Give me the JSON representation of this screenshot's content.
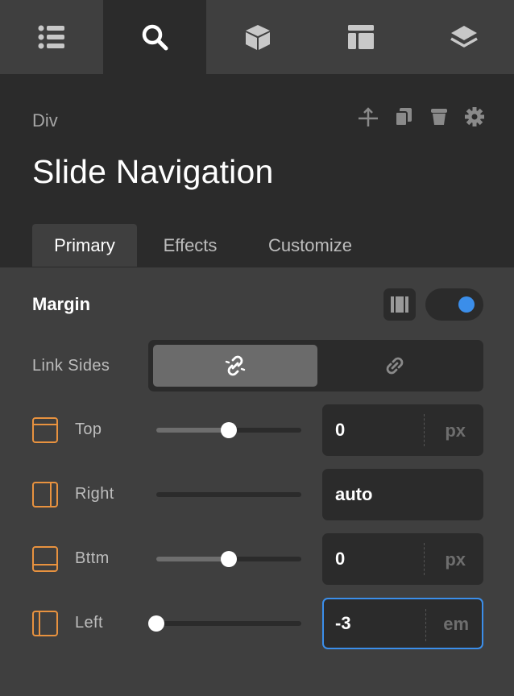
{
  "toolbar": {
    "buttons": [
      {
        "icon": "list-icon",
        "active": false
      },
      {
        "icon": "search-icon",
        "active": true
      },
      {
        "icon": "cube-icon",
        "active": false
      },
      {
        "icon": "layout-icon",
        "active": false
      },
      {
        "icon": "layers-icon",
        "active": false
      }
    ]
  },
  "header": {
    "type_label": "Div",
    "title": "Slide Navigation",
    "actions": [
      "select-parent-icon",
      "duplicate-icon",
      "delete-icon",
      "settings-icon"
    ]
  },
  "tabs": [
    {
      "label": "Primary",
      "active": true
    },
    {
      "label": "Effects",
      "active": false
    },
    {
      "label": "Customize",
      "active": false
    }
  ],
  "margin": {
    "title": "Margin",
    "toggle_on": true,
    "link_sides_label": "Link Sides",
    "link_sides_selected": "unlinked",
    "rows": [
      {
        "label": "Top",
        "value": "0",
        "unit": "px",
        "slider": 0.5
      },
      {
        "label": "Right",
        "value": "auto",
        "unit": "",
        "slider": null
      },
      {
        "label": "Bttm",
        "value": "0",
        "unit": "px",
        "slider": 0.5
      },
      {
        "label": "Left",
        "value": "-3",
        "unit": "em",
        "slider": 0.0,
        "focused": true
      }
    ]
  },
  "colors": {
    "accent": "#3b8eea",
    "side_icon": "#e8923f",
    "panel": "#2b2b2b",
    "background": "#3f3f3f"
  }
}
